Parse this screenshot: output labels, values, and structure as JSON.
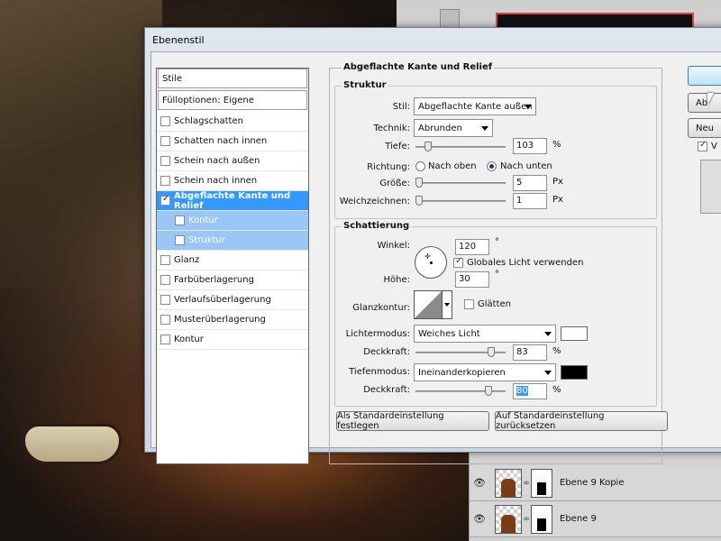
{
  "dialog": {
    "title": "Ebenenstil"
  },
  "styles": {
    "header": "Stile",
    "blend_options": "Fülloptionen: Eigene",
    "items": [
      {
        "label": "Schlagschatten",
        "checked": false
      },
      {
        "label": "Schatten nach innen",
        "checked": false
      },
      {
        "label": "Schein nach außen",
        "checked": false
      },
      {
        "label": "Schein nach innen",
        "checked": false
      },
      {
        "label": "Abgeflachte Kante und Relief",
        "checked": true,
        "selected": true
      },
      {
        "label": "Kontur",
        "checked": false,
        "sub": true
      },
      {
        "label": "Struktur",
        "checked": false,
        "sub": true
      },
      {
        "label": "Glanz",
        "checked": false
      },
      {
        "label": "Farbüberlagerung",
        "checked": false
      },
      {
        "label": "Verlaufsüberlagerung",
        "checked": false
      },
      {
        "label": "Musterüberlagerung",
        "checked": false
      },
      {
        "label": "Kontur",
        "checked": false
      }
    ]
  },
  "bevel": {
    "section_title": "Abgeflachte Kante und Relief",
    "structure": {
      "title": "Struktur",
      "style_label": "Stil:",
      "style_value": "Abgeflachte Kante außen",
      "technique_label": "Technik:",
      "technique_value": "Abrunden",
      "depth_label": "Tiefe:",
      "depth_value": "103",
      "depth_unit": "%",
      "direction_label": "Richtung:",
      "direction_up": "Nach oben",
      "direction_down": "Nach unten",
      "direction_selected": "down",
      "size_label": "Größe:",
      "size_value": "5",
      "size_unit": "Px",
      "soften_label": "Weichzeichnen:",
      "soften_value": "1",
      "soften_unit": "Px"
    },
    "shading": {
      "title": "Schattierung",
      "angle_label": "Winkel:",
      "angle_value": "120",
      "angle_unit": "°",
      "global_light_label": "Globales Licht verwenden",
      "global_light_checked": true,
      "altitude_label": "Höhe:",
      "altitude_value": "30",
      "altitude_unit": "°",
      "gloss_contour_label": "Glanzkontur:",
      "antialias_label": "Glätten",
      "antialias_checked": false,
      "highlight_mode_label": "Lichtermodus:",
      "highlight_mode_value": "Weiches Licht",
      "highlight_color": "#ffffff",
      "highlight_opacity_label": "Deckkraft:",
      "highlight_opacity_value": "83",
      "highlight_opacity_unit": "%",
      "shadow_mode_label": "Tiefenmodus:",
      "shadow_mode_value": "Ineinanderkopieren",
      "shadow_color": "#000000",
      "shadow_opacity_label": "Deckkraft:",
      "shadow_opacity_value": "80",
      "shadow_opacity_unit": "%"
    },
    "make_default_label": "Als Standardeinstellung festlegen",
    "reset_default_label": "Auf Standardeinstellung zurücksetzen"
  },
  "right_buttons": {
    "cancel_partial": "Ab",
    "new_style_partial": "Neu",
    "preview_partial": "V"
  },
  "layers": [
    {
      "name": "Ebene 9 Kopie"
    },
    {
      "name": "Ebene 9"
    }
  ]
}
